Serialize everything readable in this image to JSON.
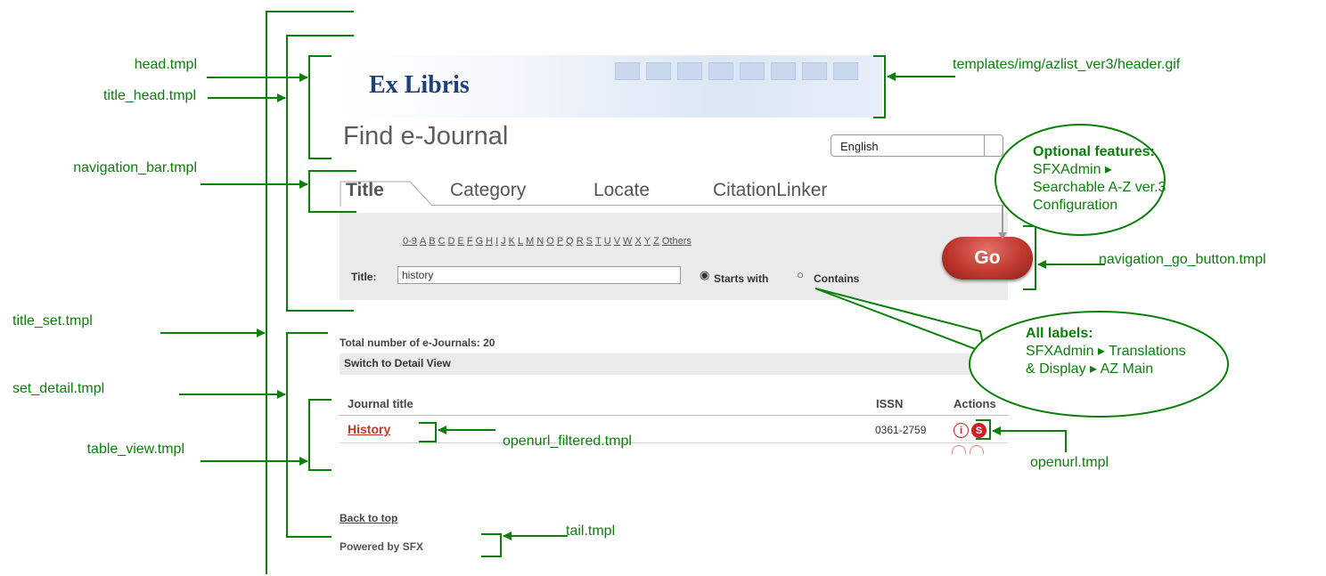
{
  "annotations": {
    "head": "head.tmpl",
    "title_head": "title_head.tmpl",
    "navigation_bar": "navigation_bar.tmpl",
    "title_set": "title_set.tmpl",
    "set_detail": "set_detail.tmpl",
    "table_view": "table_view.tmpl",
    "header_gif": "templates/img/azlist_ver3/header.gif",
    "navigation_go_button": "navigation_go_button.tmpl",
    "openurl_filtered": "openurl_filtered.tmpl",
    "openurl": "openurl.tmpl",
    "tail": "tail.tmpl"
  },
  "callouts": {
    "optional": {
      "title": "Optional features:",
      "line1": "SFXAdmin ▸",
      "line2": "Searchable A-Z ver.3",
      "line3": "Configuration"
    },
    "labels": {
      "title": "All labels:",
      "line1": "SFXAdmin ▸ Translations",
      "line2": "& Display ▸ AZ Main"
    }
  },
  "page": {
    "logo": "Ex Libris",
    "title": "Find e-Journal",
    "language": "English",
    "tabs": [
      "Title",
      "Category",
      "Locate",
      "CitationLinker"
    ],
    "alphabet": [
      "0-9",
      "A",
      "B",
      "C",
      "D",
      "E",
      "F",
      "G",
      "H",
      "I",
      "J",
      "K",
      "L",
      "M",
      "N",
      "O",
      "P",
      "Q",
      "R",
      "S",
      "T",
      "U",
      "V",
      "W",
      "X",
      "Y",
      "Z",
      "Others"
    ],
    "title_label": "Title:",
    "title_value": "history",
    "starts_with": "Starts with",
    "contains": "Contains",
    "go": "Go",
    "total": "Total number of e-Journals: 20",
    "switch_view": "Switch to Detail View",
    "col_title": "Journal title",
    "col_issn": "ISSN",
    "col_actions": "Actions",
    "row_title": "History",
    "row_issn": "0361-2759",
    "info_icon": "i",
    "back_to_top": "Back to top",
    "powered_by": "Powered by SFX"
  },
  "colors": {
    "annotation": "#0b800b",
    "go_button": "#c0392f",
    "link": "#c0392b"
  }
}
